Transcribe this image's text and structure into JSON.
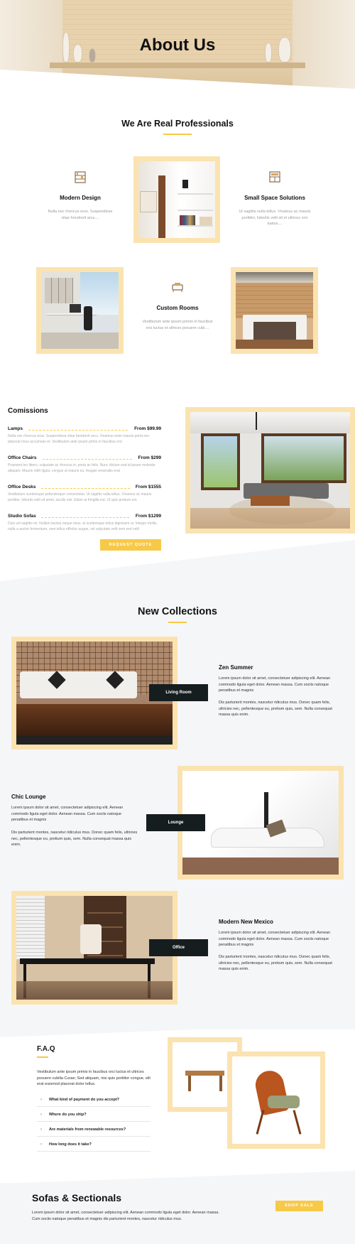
{
  "hero": {
    "title": "About Us"
  },
  "professionals": {
    "heading": "We Are Real Professionals",
    "features": [
      {
        "icon": "bookshelf-icon",
        "title": "Modern Design",
        "text": "Nulla nec rhoncus eros. Suspendisse vitae hendrerit arcu...."
      },
      {
        "icon": "cabinet-icon",
        "title": "Small Space Solutions",
        "text": "Ut sagittis nulla tellus. Vivamus ac mauris porttitor, lobortis velit sit et ultrices orci tuatus...."
      },
      {
        "icon": "sofa-bench-icon",
        "title": "Custom Rooms",
        "text": "Vestibulum ante ipsum primis in faucibus orci luctus et ultrices posuere cubi...."
      }
    ]
  },
  "commissions": {
    "heading": "Comissions",
    "items": [
      {
        "name": "Lamps",
        "price": "From $99.99",
        "desc": "Nulla nec rhoncus eros. Suspendisse vitae hendrerit arcu. Vivamus enim mauris porta nec placerat risus accumsan et. Vestibulum ante ipsum prime in faucibus orci"
      },
      {
        "name": "Office Chairs",
        "price": "From $299",
        "desc": "Praesent leo libero, vulputate ac rhoncus in, porta ac felis. Nunc dictum erat id ipsum molestie aliquam. Mauris nibh ligula, congue ut mauris eu, feugiat venenatis erat"
      },
      {
        "name": "Office Desks",
        "price": "From $1555",
        "desc": "Vestibulum scelerisque pellentesque consectetur. Ut sagittis nulla tellus. Vivamus ac mauris porttitor, lobortis velit sit amet, iaculis nisi. Etiam at fringilla est. Ut quis pretium est."
      },
      {
        "name": "Studio Sofas",
        "price": "From $1299",
        "desc": "Duis vel sagittis mi. Nullam lacinia neque risus, et scelerisque tellus dignissim ut. Integer mollis, nulla a auctor fermentum, sem tellus efficitur augue, vel vulputate velit sem sed velit"
      }
    ],
    "button": "Request Quote"
  },
  "collections": {
    "heading": "New Collections",
    "items": [
      {
        "label": "Living Room",
        "title": "Zen Summer",
        "p1": "Lorem ipsum dolor sit amet, consectetuer adipiscing elit. Aenean commodo ligula eget dolor. Aenean massa. Cum sociis natoque penatibus et magnis",
        "p2": "Dis parturient montes, nascetur ridiculus mus. Donec quam felis, ultricies nec, pellentesque eu, pretium quis, sem. Nulla consequat massa quis enim."
      },
      {
        "label": "Lounge",
        "title": "Chic Lounge",
        "p1": "Lorem ipsum dolor sit amet, consectetuer adipiscing elit. Aenean commodo ligula eget dolor. Aenean massa. Cum sociis natoque penatibus et magnis",
        "p2": "Dis parturient montes, nascetur ridiculus mus. Donec quam felis, ultricies nec, pellentesque eu, pretium quis, sem. Nulla consequat massa quis enim."
      },
      {
        "label": "Office",
        "title": "Modern New Mexico",
        "p1": "Lorem ipsum dolor sit amet, consectetuer adipiscing elit. Aenean commodo ligula eget dolor. Aenean massa. Cum sociis natoque penatibus et magnis",
        "p2": "Dis parturient montes, nascetur ridiculus mus. Donec quam felis, ultricies nec, pellentesque eu, pretium quis, sem. Nulla consequat massa quis enim."
      }
    ]
  },
  "faq": {
    "heading": "F.A.Q",
    "intro": "Vestibulum ante ipsum primis in faucibus orci luctus et ultrices posuere cubilia Curae; Sed aliquam, nisi quis porttitor congue, elit erat euismod placerat dolor tellus.",
    "questions": [
      "What kind of payment do you accept?",
      "Where do you ship?",
      "Are materials from renewable resources?",
      "How long does it take?"
    ]
  },
  "sofas": {
    "heading": "Sofas & Sectionals",
    "text": "Lorem ipsum dolor sit amet, consectetuer adipiscing elit. Aenean commodo ligula eget dolor. Aenean massa. Cum sociis natoque penatibus et magnis dis parturient montes, nascetur ridiculus mus.",
    "button": "Shop Sale"
  },
  "colors": {
    "accent": "#f7c948",
    "frame": "#fbe3b0",
    "dark": "#161d1f",
    "gray_bg": "#f5f6f8"
  }
}
